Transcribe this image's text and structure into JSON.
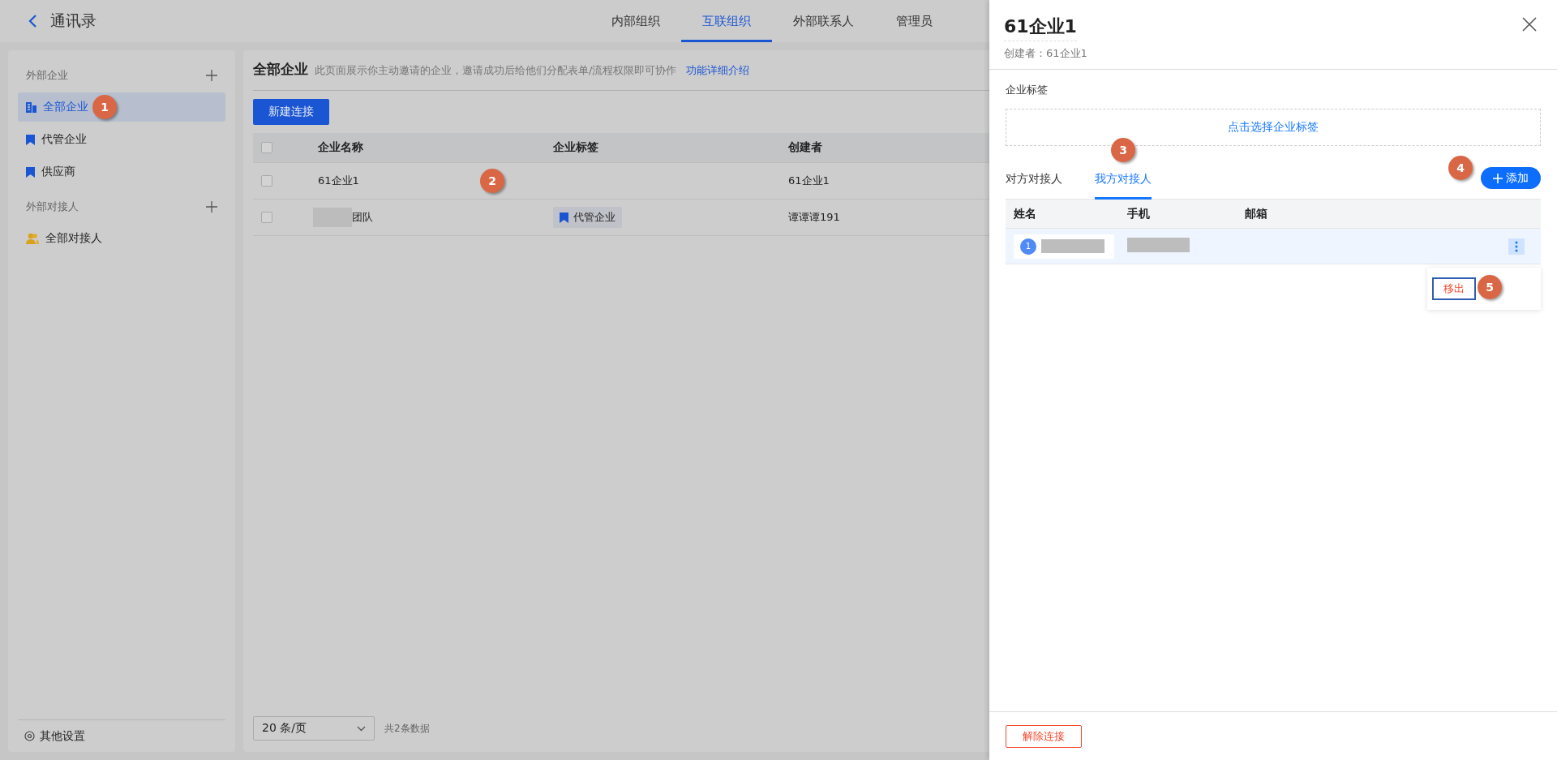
{
  "header": {
    "title": "通讯录",
    "tabs": [
      {
        "label": "内部组织",
        "selected": false
      },
      {
        "label": "互联组织",
        "selected": true
      },
      {
        "label": "外部联系人",
        "selected": false
      },
      {
        "label": "管理员",
        "selected": false
      }
    ]
  },
  "sidebar": {
    "sections": [
      {
        "title": "外部企业",
        "items": [
          {
            "label": "全部企业",
            "kind": "building",
            "selected": true,
            "marker": "1"
          },
          {
            "label": "代管企业",
            "kind": "bookmark",
            "selected": false
          },
          {
            "label": "供应商",
            "kind": "bookmark",
            "selected": false
          }
        ]
      },
      {
        "title": "外部对接人",
        "items": [
          {
            "label": "全部对接人",
            "kind": "people",
            "selected": false
          }
        ]
      }
    ],
    "footer": "其他设置"
  },
  "main": {
    "title": "全部企业",
    "description": "此页面展示你主动邀请的企业，邀请成功后给他们分配表单/流程权限即可协作",
    "link": "功能详细介绍",
    "new_button": "新建连接",
    "table": {
      "all_checked": false,
      "columns": [
        "企业名称",
        "企业标签",
        "创建者"
      ],
      "rows": [
        {
          "checked": false,
          "name": "61企业1",
          "name_redacted": false,
          "creator": "61企业1",
          "marker": "2"
        },
        {
          "checked": false,
          "name": "团队",
          "name_redacted": true,
          "tag": "代管企业",
          "creator": "谭谭谭191"
        }
      ]
    },
    "pagination": {
      "page_size": "20 条/页",
      "total": "共2条数据"
    }
  },
  "panel": {
    "title": "61企业1",
    "subtitle": "创建者：61企业1",
    "tag_label": "企业标签",
    "tag_picker": "点击选择企业标签",
    "tabs": [
      {
        "label": "对方对接人",
        "selected": false
      },
      {
        "label": "我方对接人",
        "selected": true,
        "marker": "3"
      }
    ],
    "add_button": "添加",
    "add_marker": "4",
    "columns": [
      "姓名",
      "手机",
      "邮箱"
    ],
    "rows": [
      {
        "index": "1",
        "name_redacted": true,
        "phone_redacted": true
      }
    ],
    "menu": {
      "item": "移出",
      "marker": "5"
    },
    "footer_button": "解除连接"
  }
}
